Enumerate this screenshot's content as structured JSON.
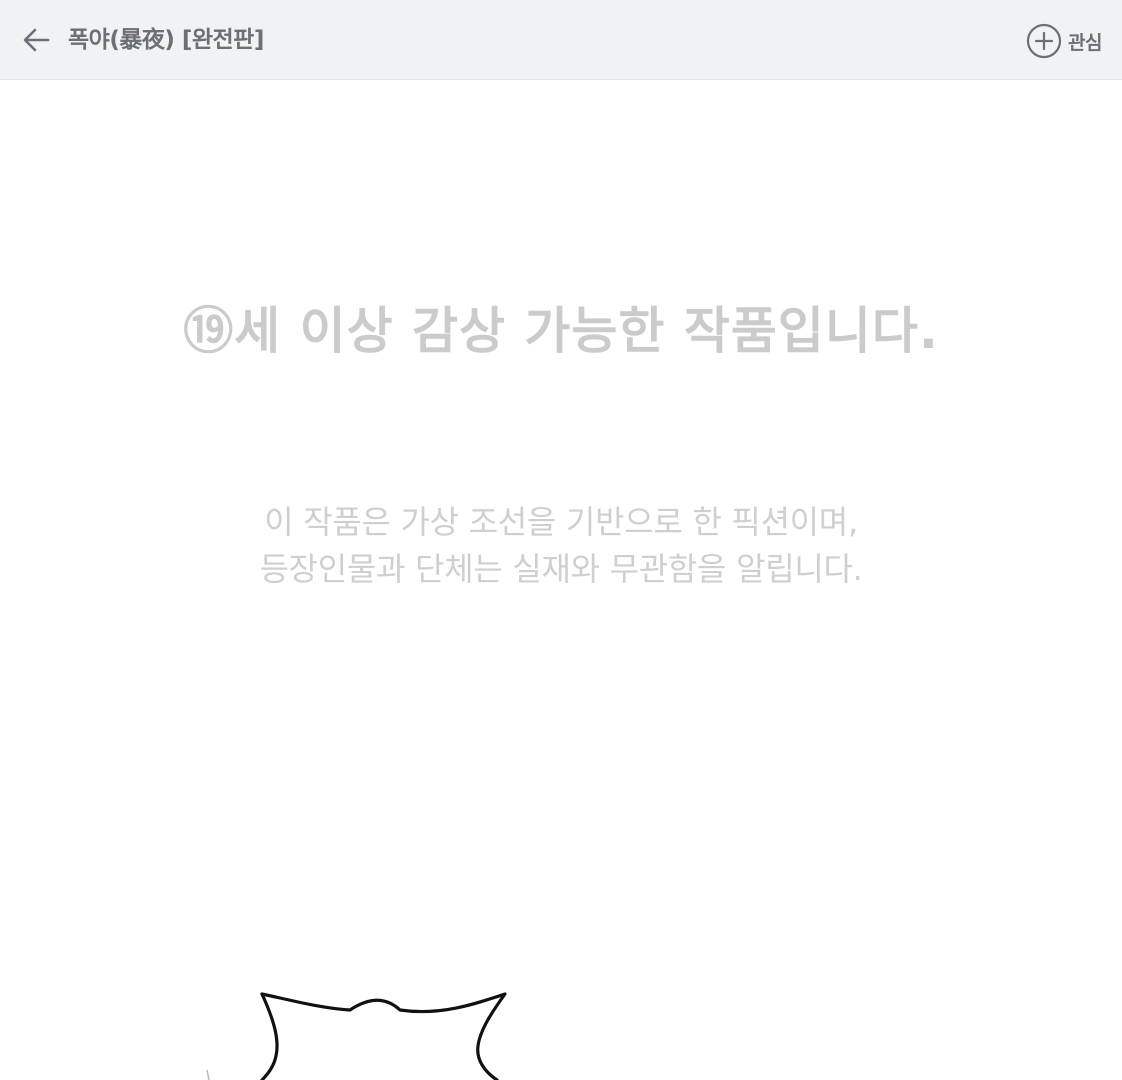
{
  "header": {
    "title": "폭야(暴夜) [완전판]",
    "back_icon": "arrow-left-icon",
    "interest_icon": "plus-circle-icon",
    "interest_label": "관심"
  },
  "main": {
    "age_notice": "⑲세 이상 감상 가능한 작품입니다.",
    "disclaimer_line1": "이 작품은 가상 조선을 기반으로 한 픽션이며,",
    "disclaimer_line2": "등장인물과 단체는 실재와 무관함을 알립니다."
  },
  "colors": {
    "header_bg": "#f1f2f4",
    "header_text": "#6b6f76",
    "notice_text": "#cbcbcb",
    "disclaimer_text": "#cfcfcf"
  }
}
